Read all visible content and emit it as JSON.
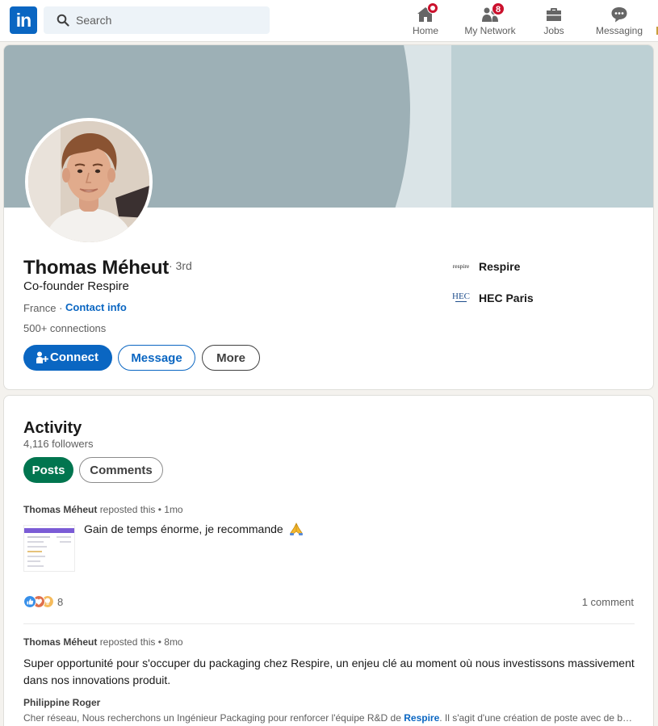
{
  "nav": {
    "search_placeholder": "Search",
    "items": [
      {
        "label": "Home",
        "icon": "home-icon",
        "badge": ""
      },
      {
        "label": "My Network",
        "icon": "network-icon",
        "badge": "8"
      },
      {
        "label": "Jobs",
        "icon": "briefcase-icon",
        "badge": ""
      },
      {
        "label": "Messaging",
        "icon": "messaging-icon",
        "badge": ""
      }
    ]
  },
  "profile": {
    "name": "Thomas Méheut",
    "degree": "· 3rd",
    "headline": "Co-founder Respire",
    "location": "France ·",
    "contact_info": "Contact info",
    "connections": "500+ connections",
    "buttons": {
      "connect": "Connect",
      "message": "Message",
      "more": "More"
    },
    "experience": [
      {
        "name": "Respire",
        "logo_text": "respire"
      },
      {
        "name": "HEC Paris",
        "logo_text": "HEC"
      }
    ]
  },
  "activity": {
    "title": "Activity",
    "followers": "4,116 followers",
    "tabs": {
      "posts": "Posts",
      "comments": "Comments"
    },
    "posts": [
      {
        "author": "Thomas Méheut",
        "action": "reposted this • 1mo",
        "text": "Gain de temps énorme, je recommande",
        "reaction_count": "8",
        "comment_count": "1 comment"
      },
      {
        "author": "Thomas Méheut",
        "action": "reposted this • 8mo",
        "text": "Super opportunité pour s'occuper du packaging chez Respire, un enjeu clé au moment où nous investissons massivement dans nos innovations produit.",
        "reshared_author": "Philippine Roger",
        "reshared_text_before": "Cher réseau, Nous recherchons un Ingénieur Packaging pour renforcer l'équipe R&D de ",
        "reshared_mention": "Respire",
        "reshared_text_after": ". Il s'agit d'une création de poste avec de belles perspectives d'évolution"
      }
    ]
  },
  "colors": {
    "brand": "#0a66c2",
    "posts_pill": "#01754f",
    "notification": "#cb112d",
    "banner_arc": "#9db0b6",
    "banner_panel": "#bdd0d4"
  }
}
